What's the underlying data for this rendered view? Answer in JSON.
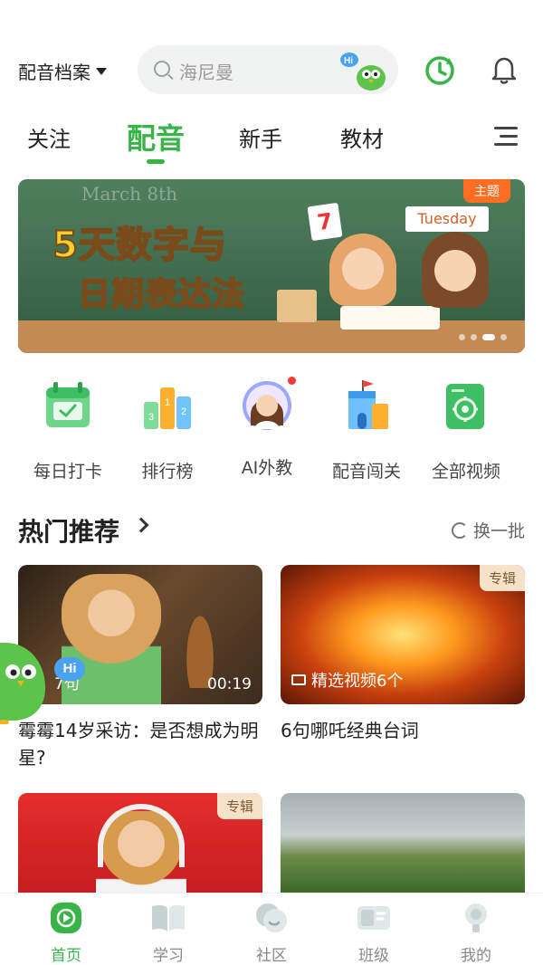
{
  "header": {
    "archive_label": "配音档案",
    "search_placeholder": "海尼曼",
    "search_mascot_text": "Hi"
  },
  "tabs": [
    {
      "label": "关注",
      "active": false
    },
    {
      "label": "配音",
      "active": true
    },
    {
      "label": "新手",
      "active": false
    },
    {
      "label": "教材",
      "active": false
    }
  ],
  "banner": {
    "badge": "主题",
    "title_line1": "5天数字与",
    "title_line2": "日期表达法",
    "board_text": "March 8th",
    "card_number": "7",
    "card_day": "Tuesday"
  },
  "quick_entries": [
    {
      "label": "每日打卡",
      "icon": "calendar-check-icon"
    },
    {
      "label": "排行榜",
      "icon": "podium-icon"
    },
    {
      "label": "AI外教",
      "icon": "ai-teacher-avatar-icon",
      "dot": true
    },
    {
      "label": "配音闯关",
      "icon": "castle-icon"
    },
    {
      "label": "全部视频",
      "icon": "video-target-icon"
    }
  ],
  "section": {
    "title": "热门推荐",
    "refresh_label": "换一批"
  },
  "cards": [
    {
      "caption": "霉霉14岁采访：是否想成为明星?",
      "count": "7句",
      "duration": "00:19"
    },
    {
      "caption": "6句哪吒经典台词",
      "album": "专辑",
      "selection": "精选视频6个"
    },
    {
      "album": "专辑"
    },
    {}
  ],
  "bottom_nav": [
    {
      "label": "首页",
      "icon": "home-play-icon",
      "active": true
    },
    {
      "label": "学习",
      "icon": "book-icon",
      "active": false
    },
    {
      "label": "社区",
      "icon": "community-icon",
      "active": false
    },
    {
      "label": "班级",
      "icon": "class-icon",
      "active": false
    },
    {
      "label": "我的",
      "icon": "profile-icon",
      "active": false
    }
  ],
  "colors": {
    "accent": "#39b547",
    "badge": "#ff6d22",
    "album_tag_bg": "#f6e2c9"
  }
}
